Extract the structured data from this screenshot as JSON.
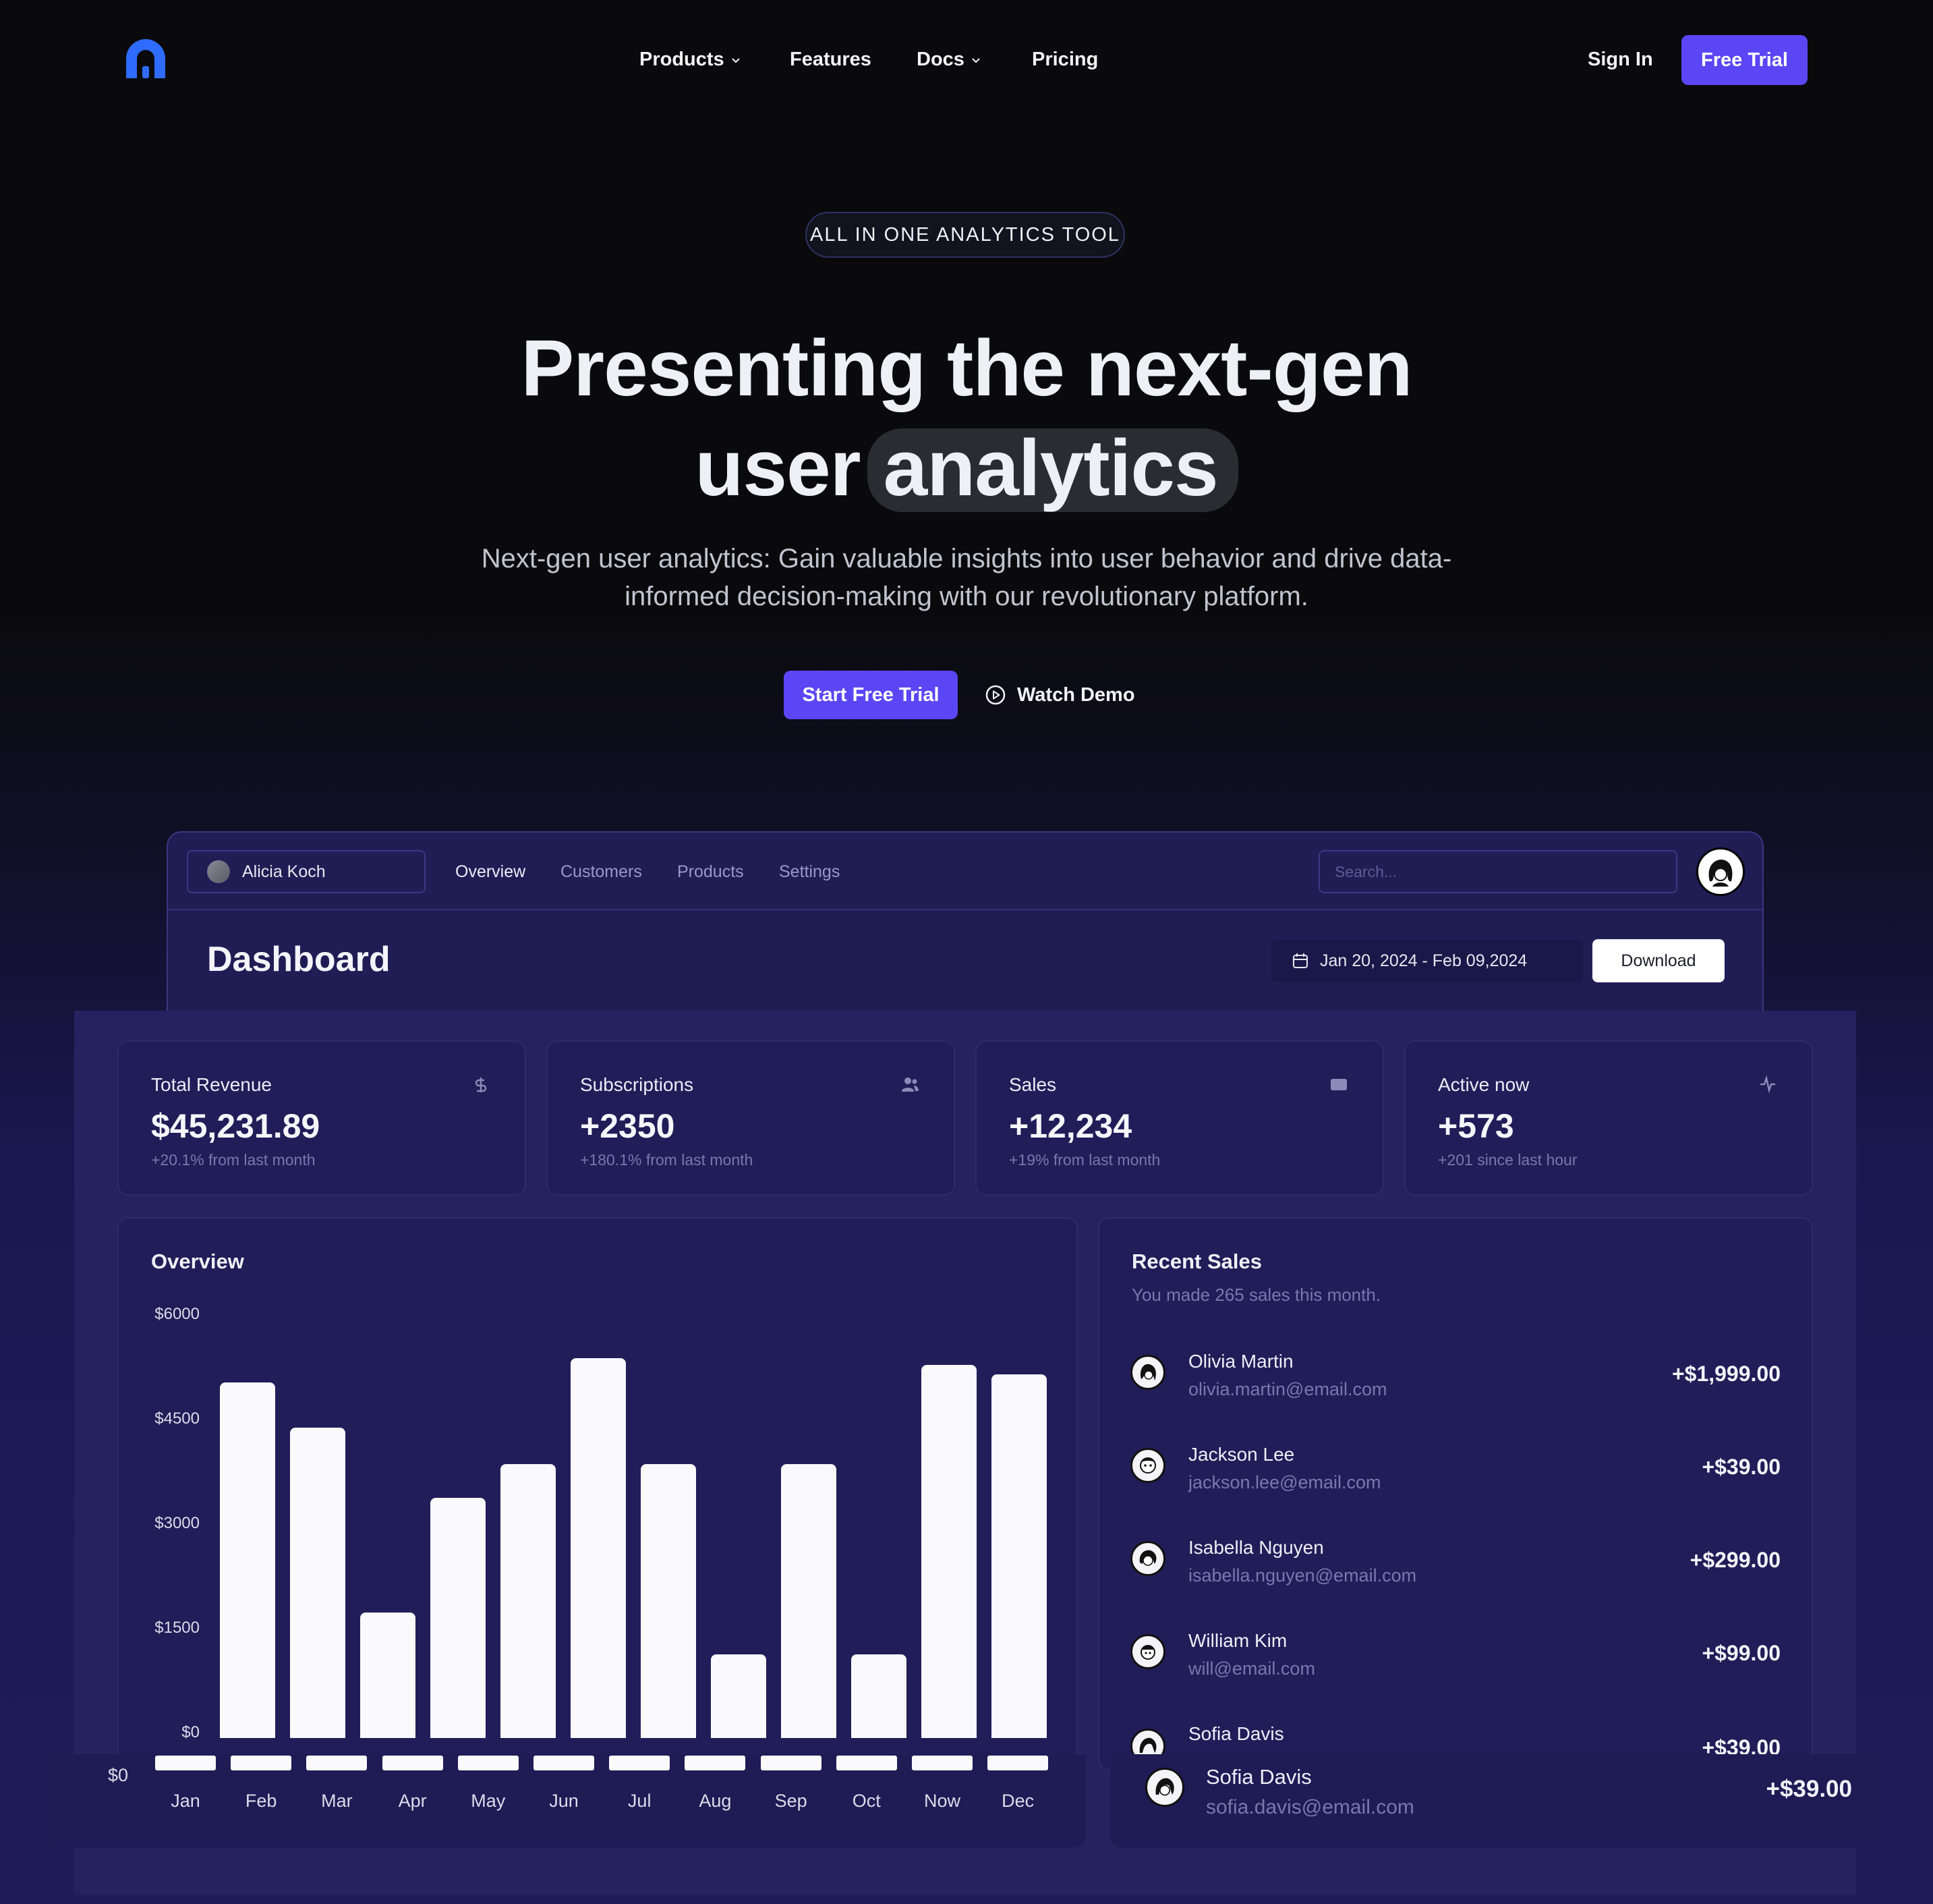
{
  "nav": {
    "links": [
      {
        "label": "Products",
        "has_dropdown": true
      },
      {
        "label": "Features",
        "has_dropdown": false
      },
      {
        "label": "Docs",
        "has_dropdown": true
      },
      {
        "label": "Pricing",
        "has_dropdown": false
      }
    ],
    "sign_in": "Sign In",
    "free_trial": "Free Trial",
    "accent": "#5b46f5",
    "logo_color": "#2f6bff"
  },
  "hero": {
    "badge": "ALL IN ONE ANALYTICS TOOL",
    "title_line1": "Presenting the next-gen",
    "title_line2_plain": "user",
    "title_line2_highlight": "analytics",
    "subtitle": "Next-gen user analytics: Gain valuable insights into user behavior and drive data-informed decision-making with our revolutionary platform.",
    "cta_primary": "Start Free Trial",
    "cta_secondary": "Watch Demo"
  },
  "dashboard": {
    "team": "Alicia Koch",
    "tabs": [
      "Overview",
      "Customers",
      "Products",
      "Settings"
    ],
    "active_tab": "Overview",
    "search_placeholder": "Search...",
    "title": "Dashboard",
    "date_range": "Jan 20, 2024 - Feb 09,2024",
    "download": "Download",
    "stats": [
      {
        "label": "Total Revenue",
        "value": "$45,231.89",
        "sub": "+20.1% from last month",
        "icon": "dollar-icon"
      },
      {
        "label": "Subscriptions",
        "value": "+2350",
        "sub": "+180.1% from last month",
        "icon": "users-icon"
      },
      {
        "label": "Sales",
        "value": "+12,234",
        "sub": "+19% from last month",
        "icon": "credit-card-icon"
      },
      {
        "label": "Active now",
        "value": "+573",
        "sub": "+201 since last hour",
        "icon": "activity-icon"
      }
    ],
    "overview_title": "Overview",
    "recent_sales": {
      "title": "Recent Sales",
      "subtitle": "You made 265 sales this month.",
      "items": [
        {
          "name": "Olivia Martin",
          "email": "olivia.martin@email.com",
          "amount": "+$1,999.00"
        },
        {
          "name": "Jackson Lee",
          "email": "jackson.lee@email.com",
          "amount": "+$39.00"
        },
        {
          "name": "Isabella Nguyen",
          "email": "isabella.nguyen@email.com",
          "amount": "+$299.00"
        },
        {
          "name": "William Kim",
          "email": "will@email.com",
          "amount": "+$99.00"
        },
        {
          "name": "Sofia Davis",
          "email": "",
          "amount": "+$39.00"
        }
      ],
      "overlay_item": {
        "name": "Sofia Davis",
        "email": "sofia.davis@email.com",
        "amount": "+$39.00"
      }
    }
  },
  "chart_data": {
    "type": "bar",
    "title": "Overview",
    "categories": [
      "Jan",
      "Feb",
      "Mar",
      "Apr",
      "May",
      "Jun",
      "Jul",
      "Aug",
      "Sep",
      "Oct",
      "Now",
      "Dec"
    ],
    "plotted_categories": [
      "Feb",
      "Mar",
      "Apr",
      "May",
      "Jun",
      "Jul",
      "Aug",
      "Sep",
      "Oct",
      "Now",
      "Dec",
      "Jan"
    ],
    "values": [
      5100,
      4450,
      1800,
      3450,
      3930,
      5450,
      3930,
      1200,
      3930,
      1200,
      5350,
      5220
    ],
    "y_ticks": [
      "$6000",
      "$4500",
      "$3000",
      "$1500",
      "$0"
    ],
    "y_ticks_lower": [
      "$0"
    ],
    "ylim": [
      0,
      6000
    ],
    "bar_color": "#fafafc"
  }
}
